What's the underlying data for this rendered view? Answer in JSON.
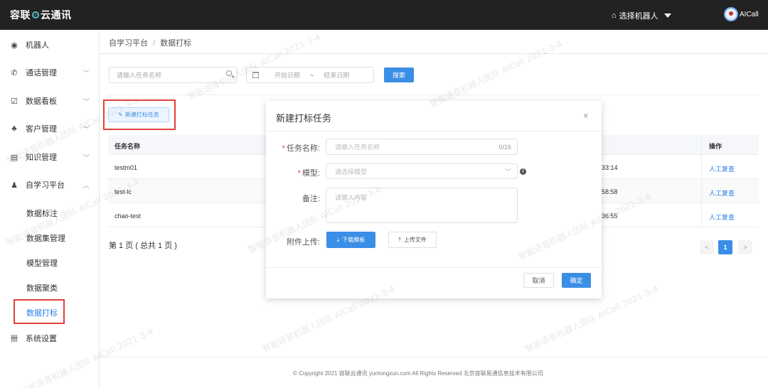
{
  "topbar": {
    "logo_left": "容联",
    "logo_right": "云通讯",
    "robot_select": "选择机器人",
    "user": "AICall"
  },
  "sidebar": {
    "items": [
      {
        "label": "机器人",
        "icon": "robot-icon"
      },
      {
        "label": "通话管理",
        "icon": "phone-icon"
      },
      {
        "label": "数据看板",
        "icon": "chart-icon"
      },
      {
        "label": "客户管理",
        "icon": "users-icon"
      },
      {
        "label": "知识管理",
        "icon": "book-icon"
      },
      {
        "label": "自学习平台",
        "icon": "learning-icon"
      },
      {
        "label": "系统设置",
        "icon": "settings-icon"
      }
    ],
    "sub_items": [
      "数据标注",
      "数据集管理",
      "模型管理",
      "数据聚类",
      "数据打标"
    ]
  },
  "breadcrumb": {
    "parent": "自学习平台",
    "separator": "/",
    "current": "数据打标"
  },
  "filters": {
    "search_placeholder": "请输入任务名称",
    "start_date": "开始日期",
    "date_sep": "~",
    "end_date": "结束日期",
    "search_button": "搜索"
  },
  "new_task_button": "新建打标任务",
  "table": {
    "headers": [
      "任务名称",
      "操作"
    ],
    "rows": [
      {
        "name": "testm01",
        "time": "33:14",
        "action": "人工复查"
      },
      {
        "name": "test-lc",
        "time": "58:58",
        "action": "人工复查"
      },
      {
        "name": "chao-test",
        "time": "36:55",
        "action": "人工复查"
      }
    ]
  },
  "pagination": {
    "info": "第 1 页 ( 总共 1 页 )",
    "current": "1",
    "prev": "<",
    "next": ">"
  },
  "footer": "© Copyright 2021   容联云通讯   yuntongxun.com   All Rights Reserved  北京容联易通信息技术有限公司",
  "modal": {
    "title": "新建打标任务",
    "close": "×",
    "task_name_label": "任务名称:",
    "task_name_placeholder": "请输入任务名称",
    "task_name_counter": "0/16",
    "model_label": "模型:",
    "model_placeholder": "请选择模型",
    "remark_label": "备注:",
    "remark_placeholder": "请输入内容",
    "attachment_label": "附件上传:",
    "download_button": "下载模板",
    "upload_button": "上传文件",
    "cancel_button": "取消",
    "confirm_button": "确定"
  },
  "watermark": {
    "text": "智能语音机器人团队  AICall  2021-3-4"
  }
}
